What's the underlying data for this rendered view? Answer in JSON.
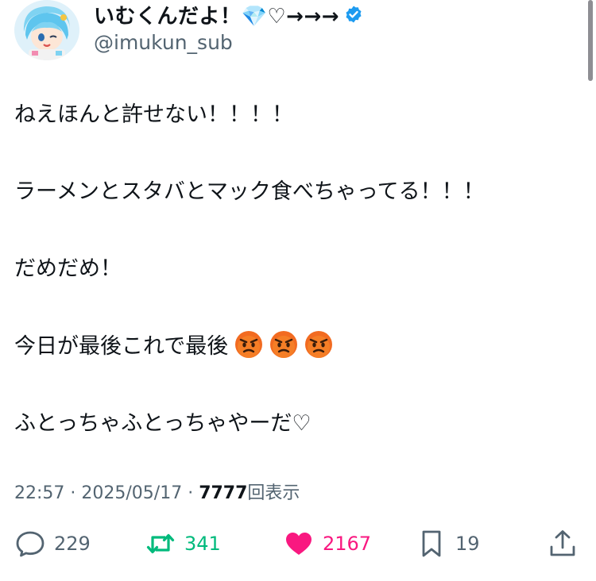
{
  "author": {
    "display_name": "いむくんだよ！💎♡→→→",
    "handle": "@imukun_sub",
    "verified": true
  },
  "tweet": {
    "paragraphs": [
      "ねえほんと許せない！！！！",
      "ラーメンとスタバとマック食べちゃってる！！！",
      "だめだめ！",
      "今日が最後これで最後",
      "ふとっちゃふとっちゃやーだ♡"
    ],
    "emoji_count_after_para4": 3
  },
  "meta": {
    "time": "22:57",
    "sep1": " · ",
    "date": "2025/05/17",
    "sep2": " · ",
    "views_count": "7777",
    "views_label": "回表示"
  },
  "actions": {
    "replies": "229",
    "retweets": "341",
    "likes": "2167",
    "bookmarks": "19"
  },
  "colors": {
    "text": "#0f1419",
    "secondary": "#536471",
    "verified": "#1d9bf0",
    "retweet": "#00ba7c",
    "like": "#f91880"
  },
  "icons": {
    "reply": "speech-bubble-icon",
    "retweet": "repost-arrows-icon",
    "like": "heart-icon",
    "bookmark": "bookmark-icon",
    "share": "share-upload-icon",
    "emoji": "angry-face-icon"
  }
}
